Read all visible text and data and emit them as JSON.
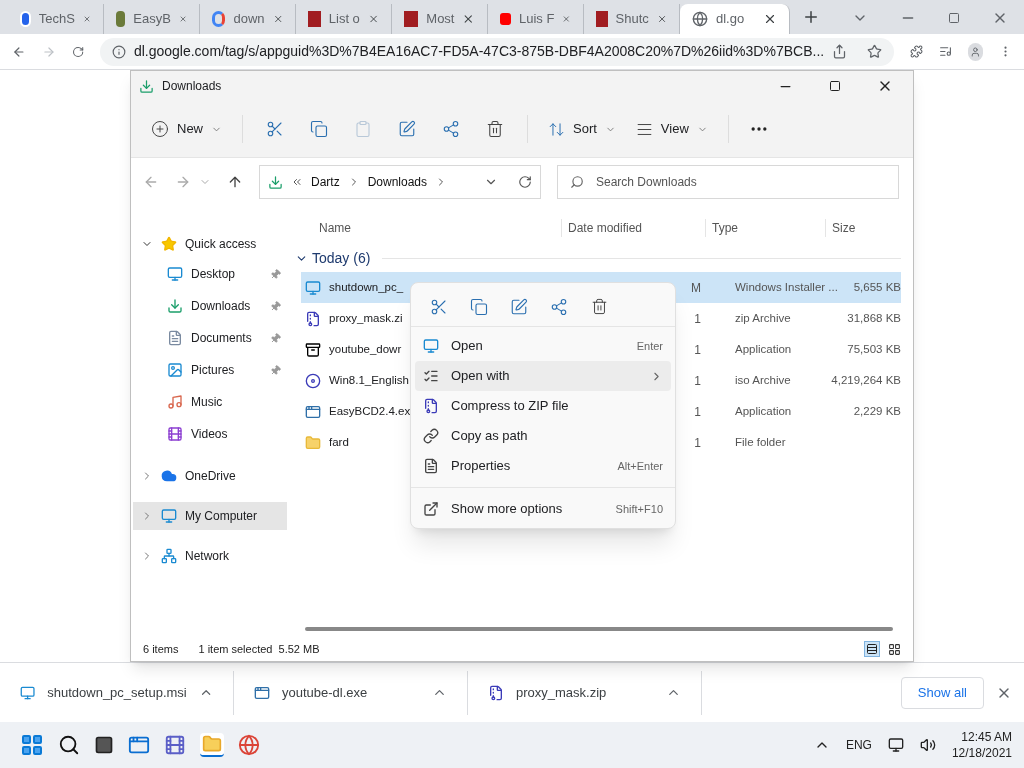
{
  "browser": {
    "tabs": [
      {
        "title": "TechS",
        "kind": "circle",
        "selected": false
      },
      {
        "title": "EasyB",
        "kind": "app",
        "selected": false
      },
      {
        "title": "down",
        "kind": "g",
        "selected": false
      },
      {
        "title": "List o",
        "kind": "r",
        "selected": false
      },
      {
        "title": "Most",
        "kind": "r",
        "selected": false
      },
      {
        "title": "Luis F",
        "kind": "video",
        "selected": false
      },
      {
        "title": "Shutc",
        "kind": "r",
        "selected": false
      },
      {
        "title": "dl.go",
        "kind": "globe",
        "selected": true
      }
    ],
    "url": "dl.google.com/tag/s/appguid%3D%7B4EA16AC7-FD5A-47C3-875B-DBF4A2008C20%7D%26iid%3D%7BCB..."
  },
  "explorer": {
    "title": "Downloads",
    "toolbar": {
      "new": "New",
      "sort": "Sort",
      "view": "View"
    },
    "breadcrumb": [
      "Dartz",
      "Downloads"
    ],
    "search": {
      "placeholder": "Search Downloads"
    },
    "columns": [
      "Name",
      "Date modified",
      "Type",
      "Size"
    ],
    "group": {
      "label": "Today (6)",
      "expanded": true
    },
    "files": [
      {
        "name": "shutdown_pc_",
        "date": "M",
        "type": "Windows Installer ...",
        "size": "5,655 KB",
        "kind": "msi",
        "selected": true
      },
      {
        "name": "proxy_mask.zi",
        "date": "1",
        "type": "zip Archive",
        "size": "31,868 KB",
        "kind": "zip",
        "selected": false
      },
      {
        "name": "youtube_dowr",
        "date": "1",
        "type": "Application",
        "size": "75,503 KB",
        "kind": "sevenzip",
        "selected": false
      },
      {
        "name": "Win8.1_English",
        "date": "1",
        "type": "iso Archive",
        "size": "4,219,264 KB",
        "kind": "iso",
        "selected": false
      },
      {
        "name": "EasyBCD2.4.ex",
        "date": "1",
        "type": "Application",
        "size": "2,229 KB",
        "kind": "exe",
        "selected": false
      },
      {
        "name": "fard",
        "date": "1",
        "type": "File folder",
        "kind": "folder",
        "selected": false
      }
    ],
    "nav": [
      {
        "label": "Quick access",
        "kind": "star",
        "expanded": true,
        "selected": false,
        "children": [
          {
            "label": "Desktop",
            "kind": "desktop",
            "pinned": true,
            "selected": false
          },
          {
            "label": "Downloads",
            "kind": "download",
            "pinned": true,
            "selected": false
          },
          {
            "label": "Documents",
            "kind": "doc",
            "pinned": true,
            "selected": false
          },
          {
            "label": "Pictures",
            "kind": "pictures",
            "pinned": true,
            "selected": false
          },
          {
            "label": "Music",
            "kind": "music",
            "pinned": false,
            "selected": false
          },
          {
            "label": "Videos",
            "kind": "videos",
            "pinned": false,
            "selected": false
          }
        ]
      },
      {
        "label": "OneDrive",
        "kind": "cloud",
        "expanded": false,
        "selected": false
      },
      {
        "label": "My Computer",
        "kind": "pc",
        "expanded": false,
        "selected": true
      },
      {
        "label": "Network",
        "kind": "network",
        "expanded": false,
        "selected": false
      }
    ],
    "status": {
      "count": "6 items",
      "selection": "1 item selected",
      "size": "5.52 MB"
    },
    "context_menu": {
      "items": [
        {
          "label": "Open",
          "shortcut": "Enter",
          "kind": "msi",
          "submenu": false,
          "selected": false
        },
        {
          "label": "Open with",
          "kind": "openwith",
          "submenu": true,
          "selected": true
        },
        {
          "label": "Compress to ZIP file",
          "kind": "zip",
          "submenu": false,
          "selected": false
        },
        {
          "label": "Copy as path",
          "kind": "path",
          "submenu": false,
          "selected": false
        },
        {
          "label": "Properties",
          "shortcut": "Alt+Enter",
          "kind": "props",
          "submenu": false,
          "selected": false
        },
        {
          "label": "Show more options",
          "shortcut": "Shift+F10",
          "kind": "more",
          "submenu": false,
          "selected": false,
          "divider_before": true
        }
      ]
    }
  },
  "downloads_bar": {
    "items": [
      {
        "name": "shutdown_pc_setup.msi",
        "kind": "msi"
      },
      {
        "name": "youtube-dl.exe",
        "kind": "exe"
      },
      {
        "name": "proxy_mask.zip",
        "kind": "zip"
      }
    ],
    "show_all": "Show all"
  },
  "taskbar": {
    "language": "ENG",
    "time": "12:45 AM",
    "date": "12/18/2021"
  }
}
